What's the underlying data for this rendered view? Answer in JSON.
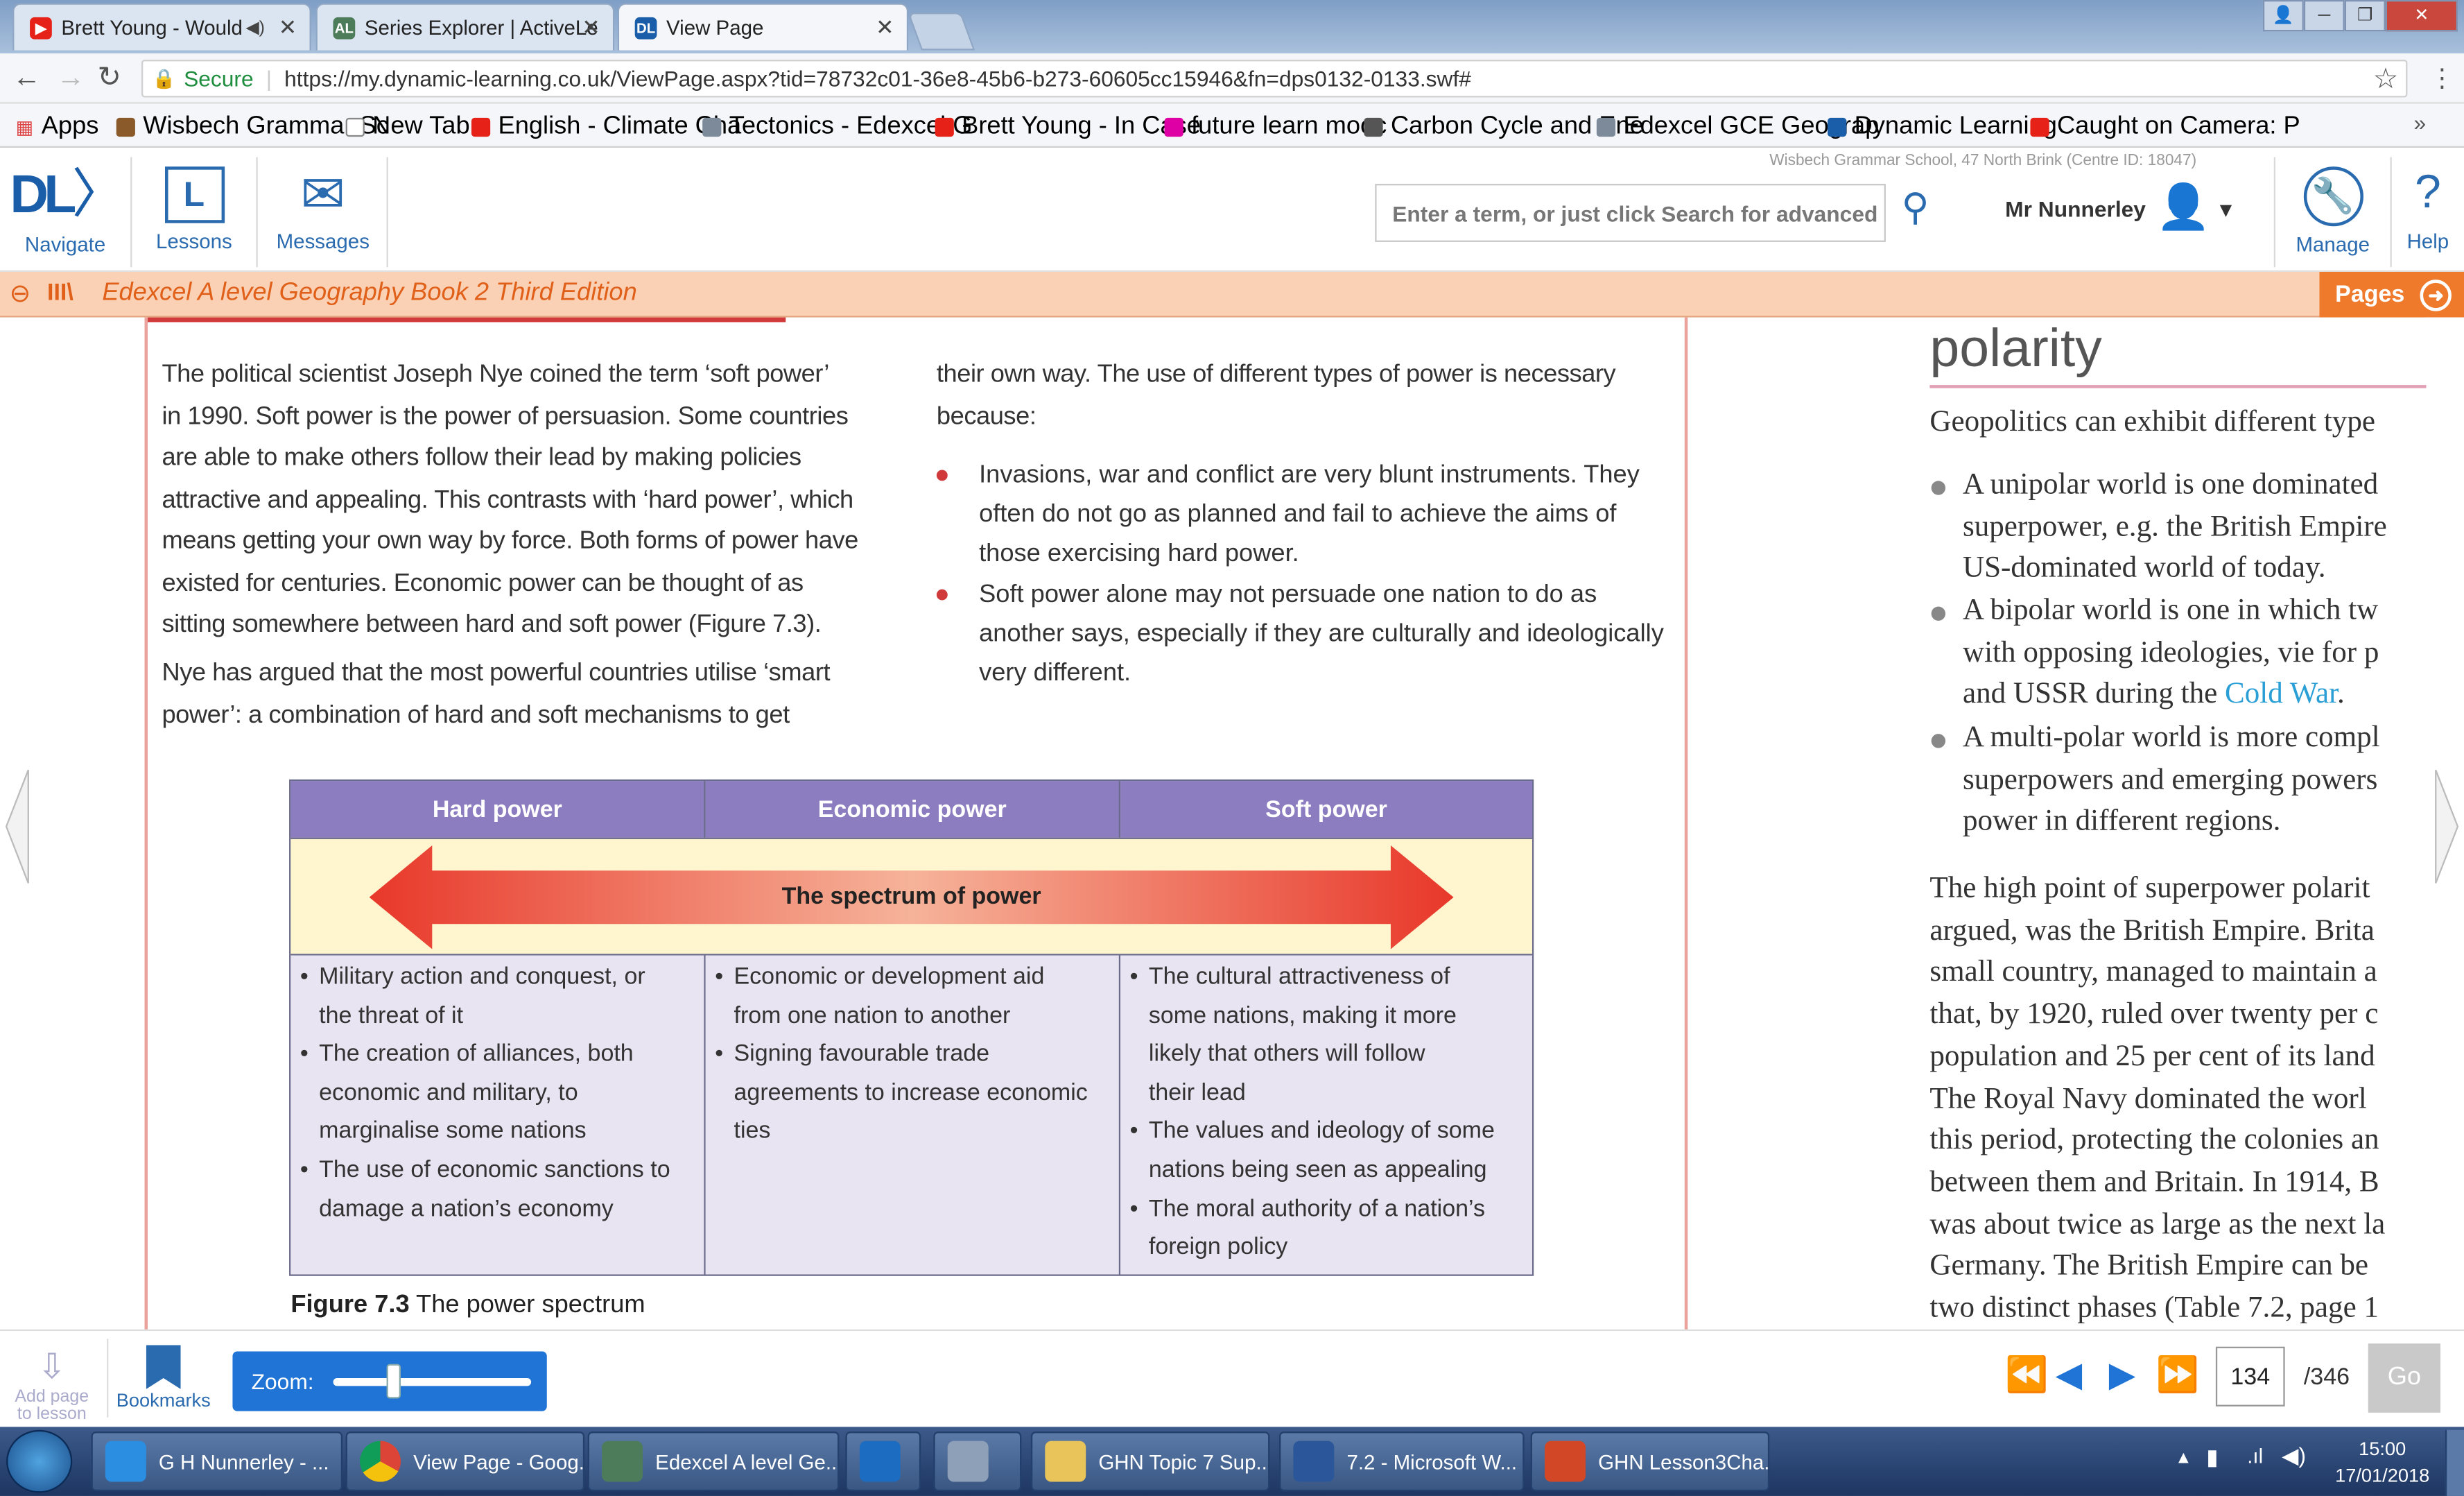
{
  "browser": {
    "tabs": [
      {
        "label": "Brett Young - Would ",
        "icon": "youtube-icon",
        "active": false
      },
      {
        "label": "Series Explorer | ActiveLe",
        "icon": "activelearn-icon",
        "active": false
      },
      {
        "label": "View Page",
        "icon": "dynamic-learning-icon",
        "active": true
      }
    ],
    "secure_label": "Secure",
    "url": "https://my.dynamic-learning.co.uk/ViewPage.aspx?tid=78732c01-36e8-45b6-b273-60605cc15946&fn=dps0132-0133.swf#",
    "bookmarks": [
      "Apps",
      "Wisbech Grammar Sc",
      "New Tab",
      "English - Climate Cha",
      "Tectonics - Edexcel G",
      "Brett Young - In Case",
      "future learn mooc",
      "Carbon Cycle and Ene",
      "Edexcel GCE Geograp",
      "Dynamic Learning",
      "Caught on Camera: P"
    ]
  },
  "app": {
    "school": "Wisbech Grammar School, 47 North Brink (Centre ID: 18047)",
    "nav": {
      "navigate": "Navigate",
      "lessons": "Lessons",
      "messages": "Messages"
    },
    "search_placeholder": "Enter a term, or just click Search for advanced",
    "user": "Mr Nunnerley",
    "manage": "Manage",
    "help": "Help",
    "book_title": "Edexcel A level Geography Book 2 Third Edition",
    "pages_label": "Pages"
  },
  "page": {
    "para1_lines": [
      "The political scientist Joseph Nye coined the term ‘soft power’",
      "in 1990. Soft power is the power of persuasion. Some countries",
      "are able to make others follow their lead by making policies",
      "attractive and appealing. This contrasts with ‘hard power’, which",
      "means getting your own way by force. Both forms of power have",
      "existed for centuries. Economic power can be thought of as",
      "sitting somewhere between hard and soft power (Figure 7.3)."
    ],
    "para2_lines": [
      "Nye has argued that the most powerful countries utilise ‘smart",
      "power’: a combination of hard and soft mechanisms to get"
    ],
    "col2_lines": [
      "their own way. The use of different types of power is necessary",
      "because:"
    ],
    "bullets": [
      [
        "Invasions, war and conflict are very blunt instruments. They",
        "often do not go as planned and fail to achieve the aims of",
        "those exercising hard power."
      ],
      [
        "Soft power alone may not persuade one nation to do as",
        "another says, especially if they are culturally and ideologically",
        "very different."
      ]
    ],
    "table": {
      "headers": [
        "Hard power",
        "Economic power",
        "Soft power"
      ],
      "spectrum_label": "The spectrum of power",
      "hard": [
        [
          "Military action and conquest, or",
          "the threat of it"
        ],
        [
          "The creation of alliances, both",
          "economic and military, to",
          "marginalise some nations"
        ],
        [
          "The use of economic sanctions to",
          "damage a nation’s economy"
        ]
      ],
      "economic": [
        [
          "Economic or development aid",
          "from one nation to another"
        ],
        [
          "Signing favourable trade",
          "agreements to increase economic",
          "ties"
        ]
      ],
      "soft": [
        [
          "The cultural attractiveness of",
          "some nations, making it more",
          "likely that others will follow",
          "their lead"
        ],
        [
          "The values and ideology of some",
          "nations being seen as appealing"
        ],
        [
          "The moral authority of a nation’s",
          "foreign policy"
        ]
      ]
    },
    "figure_num": "Figure 7.3",
    "figure_caption": "The power spectrum"
  },
  "right_page": {
    "heading": "polarity",
    "intro": "Geopolitics can exhibit different type",
    "bullets": [
      [
        "A unipolar world is one dominated",
        "superpower, e.g. the British Empire",
        "US-dominated world of today."
      ],
      [
        "A bipolar world is one in which tw",
        "with opposing ideologies, vie for p"
      ],
      [
        "A multi-polar world is more compl",
        "superpowers and emerging powers",
        "power in different regions."
      ]
    ],
    "cold_war_prefix": "and USSR during the ",
    "cold_war_link": "Cold War",
    "cold_war_suffix": ".",
    "para_lines": [
      "The high point of superpower polarit",
      "argued, was the British Empire. Brita",
      "small country, managed to maintain a",
      "that, by 1920, ruled over twenty per c",
      "population and 25 per cent of its land",
      "The Royal Navy dominated the worl",
      "this period, protecting the colonies an",
      "between them and Britain. In 1914, B",
      "was about twice as large as the next la",
      "Germany. The British Empire can be",
      "two distinct phases (Table 7.2, page 1"
    ]
  },
  "viewer": {
    "add_page": "Add page to lesson",
    "bookmarks": "Bookmarks",
    "zoom_label": "Zoom:",
    "zoom_level": 0.3,
    "current_page": "134",
    "total_pages": "/346",
    "go": "Go"
  },
  "taskbar": {
    "items": [
      "G H Nunnerley - ...",
      "View Page - Goog...",
      "Edexcel A level Ge...",
      "",
      "",
      "GHN Topic 7 Sup...",
      "7.2 - Microsoft W...",
      "GHN Lesson3Cha..."
    ],
    "time": "15:00",
    "date": "17/01/2018"
  },
  "colors": {
    "accent": "#ef7a2c",
    "table_header": "#8c7cc0",
    "link": "#2a9fd6"
  }
}
